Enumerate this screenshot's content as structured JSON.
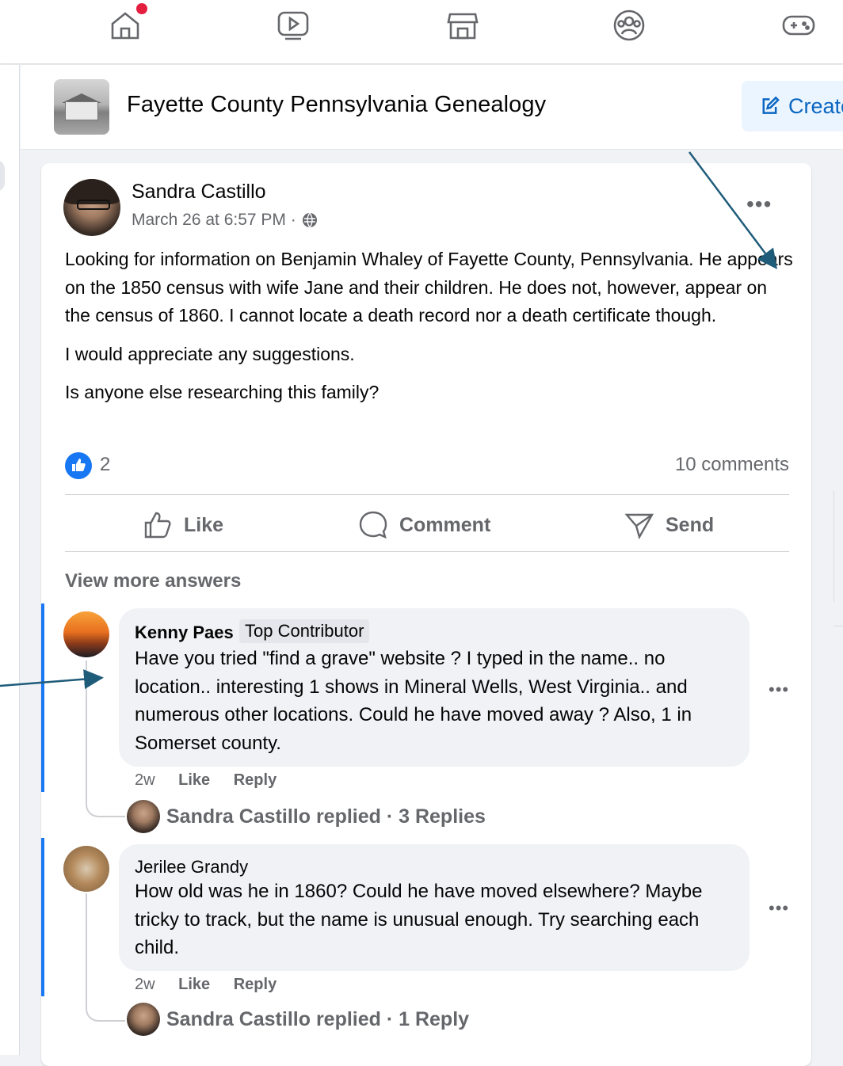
{
  "nav": {
    "icons": [
      "home-icon",
      "video-icon",
      "marketplace-icon",
      "groups-icon",
      "gaming-icon"
    ]
  },
  "group": {
    "title": "Fayette County Pennsylvania Genealogy",
    "create_label": "Create"
  },
  "post": {
    "author": "Sandra Castillo",
    "timestamp": "March 26 at 6:57 PM ·",
    "paragraphs": [
      "Looking for information on Benjamin Whaley of Fayette County, Pennsylvania. He appears on the 1850 census with wife Jane and their children. He does not, however, appear on the census of 1860. I cannot locate a death record nor a death certificate though.",
      "I would appreciate any suggestions.",
      "Is anyone else researching this family?"
    ],
    "reaction_count": "2",
    "comments_count": "10 comments",
    "actions": {
      "like": "Like",
      "comment": "Comment",
      "send": "Send"
    },
    "view_more": "View more answers"
  },
  "comments": [
    {
      "author": "Kenny Paes",
      "badge": "Top Contributor",
      "text": "Have you tried \"find a grave\" website ? I typed in the name.. no location.. interesting 1 shows in Mineral Wells, West Virginia.. and numerous other locations. Could he have moved away ? Also, 1 in Somerset county.",
      "time": "2w",
      "like": "Like",
      "reply": "Reply",
      "replies": "Sandra Castillo replied · 3 Replies"
    },
    {
      "author": "Jerilee Grandy",
      "text": "How old was he in 1860? Could he have moved elsewhere? Maybe tricky to track, but the name is unusual enough. Try searching each child.",
      "time": "2w",
      "like": "Like",
      "reply": "Reply",
      "replies": "Sandra Castillo replied · 1 Reply"
    }
  ],
  "colors": {
    "accent": "#1877f2",
    "annotation_arrow": "#1f5c7a",
    "notification": "#e41e3f"
  }
}
